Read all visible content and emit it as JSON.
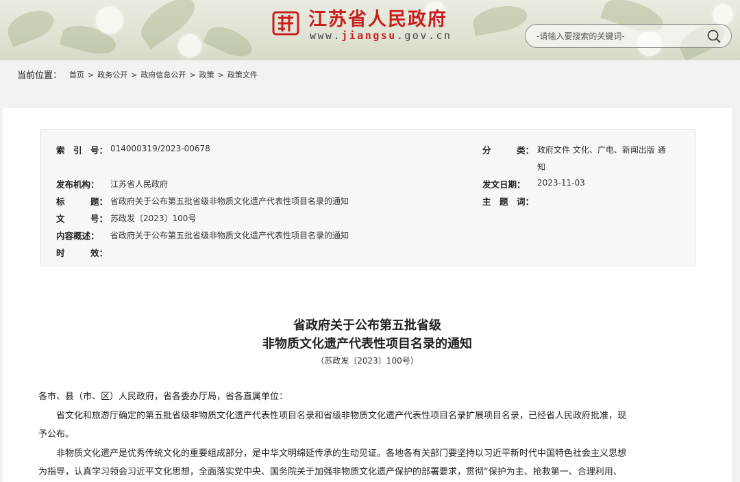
{
  "header": {
    "site_name": "江苏省人民政府",
    "url_prefix": "www.",
    "url_brand": "jiangsu",
    "url_suffix": ".gov.cn",
    "search_placeholder": "-请输入要搜索的关键词-",
    "accent": "#c81e1e"
  },
  "breadcrumb": {
    "label": "当前位置：",
    "items": [
      "首页",
      "政务公开",
      "政府信息公开",
      "政策",
      "政策文件"
    ],
    "separator": ">"
  },
  "meta": {
    "index_label": "索　引　号：",
    "index_value": "014000319/2023-00678",
    "category_label": "分　　　类：",
    "category_value_1": "政府文件 文化、广电、新闻出版 通",
    "category_value_2": "知",
    "publisher_label": "发布机构：",
    "publisher_value": "江苏省人民政府",
    "date_label": "发文日期：",
    "date_value": "2023-11-03",
    "title_label": "标　　　题：",
    "title_value": "省政府关于公布第五批省级非物质文化遗产代表性项目名录的通知",
    "subject_label": "主　题　词：",
    "subject_value": "",
    "docno_label": "文　　　号：",
    "docno_value": "苏政发〔2023〕100号",
    "summary_label": "内容概述：",
    "summary_value": "省政府关于公布第五批省级非物质文化遗产代表性项目名录的通知",
    "validity_label": "时　　　效：",
    "validity_value": ""
  },
  "document": {
    "title_line1": "省政府关于公布第五批省级",
    "title_line2": "非物质文化遗产代表性项目名录的通知",
    "doc_number": "（苏政发〔2023〕100号）",
    "salutation": "各市、县（市、区）人民政府，省各委办厅局，省各直属单位：",
    "para1_line1": "　　省文化和旅游厅确定的第五批省级非物质文化遗产代表性项目名录和省级非物质文化遗产代表性项目名录扩展项目名录，已经省人民政府批准，现",
    "para1_line2": "予公布。",
    "para2_line1": "　　非物质文化遗产是优秀传统文化的重要组成部分，是中华文明绵延传承的生动见证。各地各有关部门要坚持以习近平新时代中国特色社会主义思想",
    "para2_line2": "为指导，认真学习领会习近平文化思想，全面落实党中央、国务院关于加强非物质文化遗产保护的部署要求，贯彻“保护为主、抢救第一、合理利用、"
  }
}
